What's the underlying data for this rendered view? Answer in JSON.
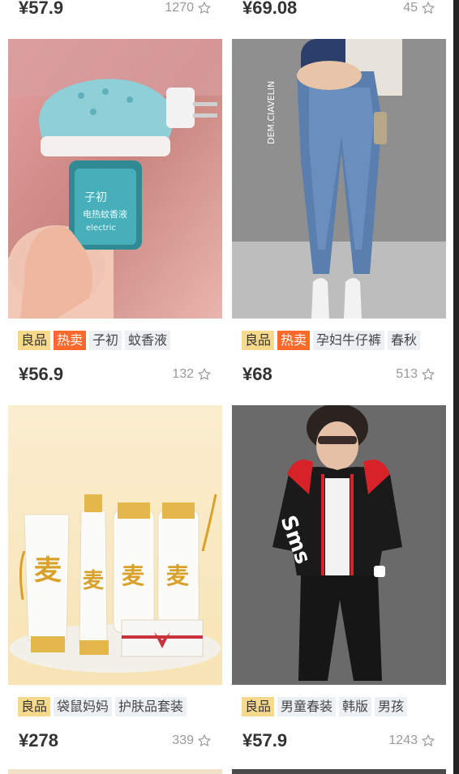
{
  "top_row": [
    {
      "price": "¥57.9",
      "favorites": "1270"
    },
    {
      "price": "¥69.08",
      "favorites": "45"
    }
  ],
  "products": [
    {
      "image": "electric-mosquito-repellent-liquid-photo",
      "tags": [
        {
          "text": "良品",
          "kind": "good"
        },
        {
          "text": "热卖",
          "kind": "hot"
        },
        {
          "text": "子初",
          "kind": "plain"
        },
        {
          "text": "蚊香液",
          "kind": "plain"
        }
      ],
      "price": "¥56.9",
      "favorites": "132"
    },
    {
      "image": "maternity-jeans-photo",
      "tags": [
        {
          "text": "良品",
          "kind": "good"
        },
        {
          "text": "热卖",
          "kind": "hot"
        },
        {
          "text": "孕妇牛仔裤",
          "kind": "plain"
        },
        {
          "text": "春秋",
          "kind": "plain"
        }
      ],
      "price": "¥68",
      "favorites": "513"
    },
    {
      "image": "skincare-set-photo",
      "tags": [
        {
          "text": "良品",
          "kind": "good"
        },
        {
          "text": "袋鼠妈妈",
          "kind": "plain"
        },
        {
          "text": "护肤品套装",
          "kind": "plain"
        }
      ],
      "price": "¥278",
      "favorites": "339"
    },
    {
      "image": "boys-tracksuit-photo",
      "tags": [
        {
          "text": "良品",
          "kind": "good"
        },
        {
          "text": "男童春装",
          "kind": "plain"
        },
        {
          "text": "韩版",
          "kind": "plain"
        },
        {
          "text": "男孩",
          "kind": "plain"
        }
      ],
      "price": "¥57.9",
      "favorites": "1243"
    }
  ],
  "image_texts": {
    "brand_vertical": "DEM.CIAVELIN",
    "bottle_label": "子初",
    "bottle_sub": "电热蚊香液",
    "bottle_en": "electric",
    "skincare_char": "麦",
    "hoodie_text": "Sms"
  },
  "colors": {
    "tag_good": "#f6d98a",
    "tag_hot": "#ff6a2c",
    "tag_plain": "#eef1f4",
    "price": "#333333",
    "favorites": "#9a9a9a"
  },
  "icons": [
    "star-outline-icon"
  ]
}
